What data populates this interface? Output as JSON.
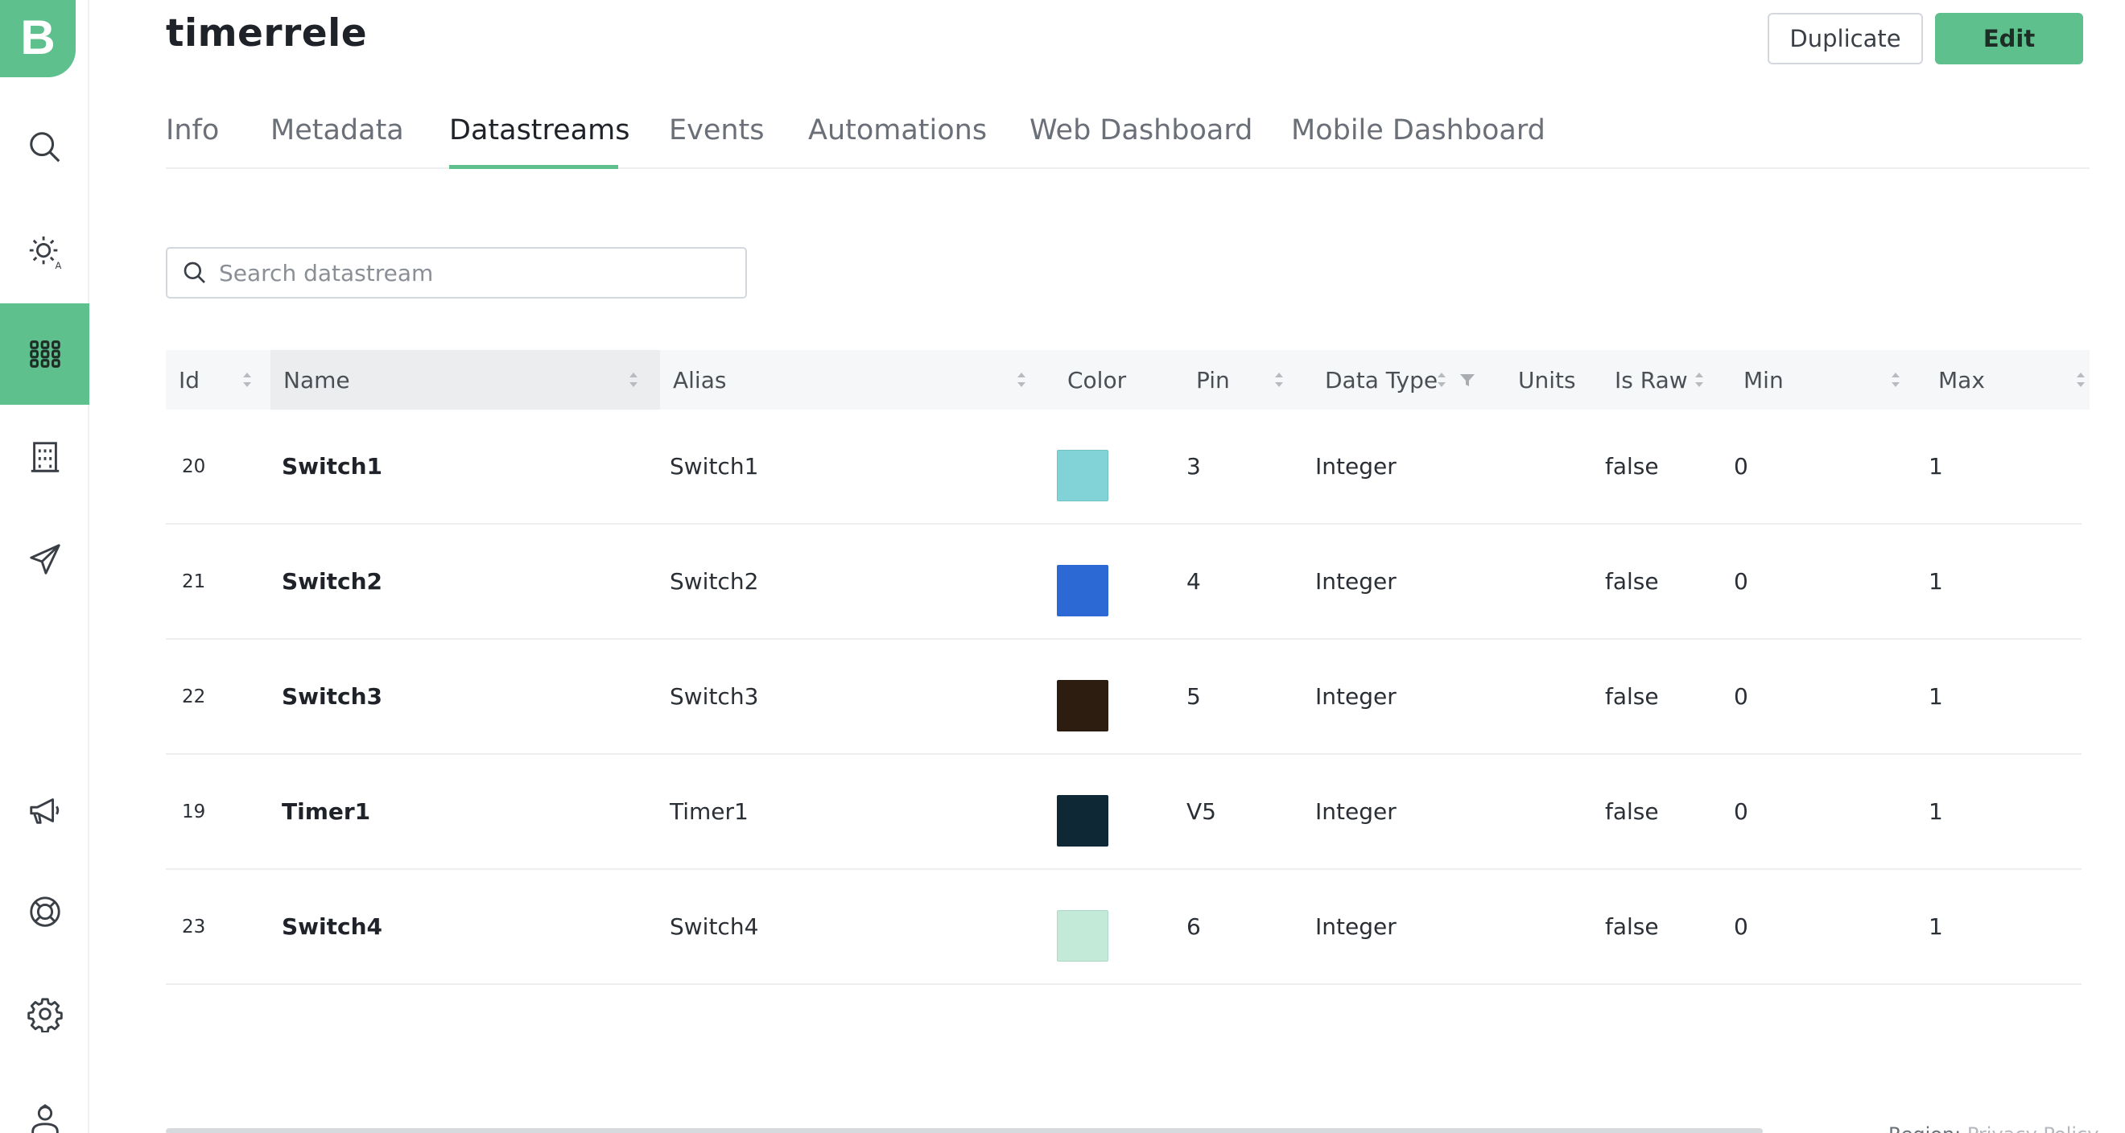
{
  "app": {
    "logo_letter": "B",
    "accent_color": "#5ec08c"
  },
  "sidebar": {
    "items": [
      {
        "name": "search-icon",
        "active": false
      },
      {
        "name": "sun-icon",
        "active": false
      },
      {
        "name": "grid-icon",
        "active": true
      },
      {
        "name": "building-icon",
        "active": false
      },
      {
        "name": "paper-plane-icon",
        "active": false
      },
      {
        "name": "megaphone-icon",
        "active": false
      },
      {
        "name": "lifebuoy-icon",
        "active": false
      },
      {
        "name": "gear-icon",
        "active": false
      },
      {
        "name": "user-icon",
        "active": false
      }
    ]
  },
  "header": {
    "title": "timerrele",
    "duplicate_label": "Duplicate",
    "edit_label": "Edit"
  },
  "tabs": [
    {
      "label": "Info",
      "active": false
    },
    {
      "label": "Metadata",
      "active": false
    },
    {
      "label": "Datastreams",
      "active": true
    },
    {
      "label": "Events",
      "active": false
    },
    {
      "label": "Automations",
      "active": false
    },
    {
      "label": "Web Dashboard",
      "active": false
    },
    {
      "label": "Mobile Dashboard",
      "active": false
    }
  ],
  "search": {
    "placeholder": "Search datastream",
    "value": ""
  },
  "table": {
    "columns": [
      "Id",
      "Name",
      "Alias",
      "Color",
      "Pin",
      "Data Type",
      "Units",
      "Is Raw",
      "Min",
      "Max"
    ],
    "sorted_column": "Name",
    "rows": [
      {
        "id": "20",
        "name": "Switch1",
        "alias": "Switch1",
        "color": "#82d3d8",
        "pin": "3",
        "data_type": "Integer",
        "units": "",
        "is_raw": "false",
        "min": "0",
        "max": "1"
      },
      {
        "id": "21",
        "name": "Switch2",
        "alias": "Switch2",
        "color": "#2c69d5",
        "pin": "4",
        "data_type": "Integer",
        "units": "",
        "is_raw": "false",
        "min": "0",
        "max": "1"
      },
      {
        "id": "22",
        "name": "Switch3",
        "alias": "Switch3",
        "color": "#2d1c10",
        "pin": "5",
        "data_type": "Integer",
        "units": "",
        "is_raw": "false",
        "min": "0",
        "max": "1"
      },
      {
        "id": "19",
        "name": "Timer1",
        "alias": "Timer1",
        "color": "#0e2836",
        "pin": "V5",
        "data_type": "Integer",
        "units": "",
        "is_raw": "false",
        "min": "0",
        "max": "1"
      },
      {
        "id": "23",
        "name": "Switch4",
        "alias": "Switch4",
        "color": "#c3e9d9",
        "pin": "6",
        "data_type": "Integer",
        "units": "",
        "is_raw": "false",
        "min": "0",
        "max": "1"
      }
    ]
  },
  "footer": {
    "link1": "Region: ",
    "link2": "Privacy Policy"
  }
}
